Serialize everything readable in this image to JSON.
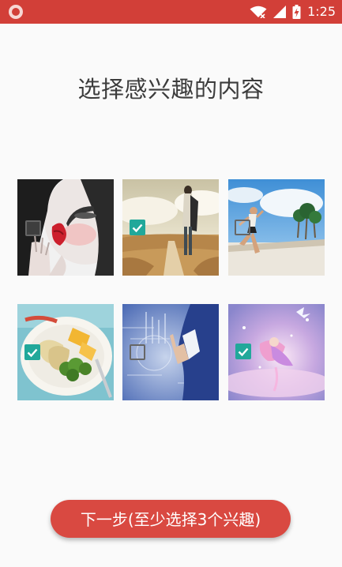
{
  "status_bar": {
    "time": "1:25",
    "background": "#d23f38",
    "icons": [
      "app-notification-icon",
      "wifi-icon",
      "cellular-signal-icon",
      "battery-charging-icon"
    ]
  },
  "page": {
    "title": "选择感兴趣的内容"
  },
  "interests": [
    {
      "name": "interest-fashion-portrait",
      "checked": false
    },
    {
      "name": "interest-travel-desert-road",
      "checked": true
    },
    {
      "name": "interest-running-beach",
      "checked": false
    },
    {
      "name": "interest-food-plate",
      "checked": true
    },
    {
      "name": "interest-technology-hand",
      "checked": false
    },
    {
      "name": "interest-fantasy-art",
      "checked": true
    }
  ],
  "actions": {
    "next_label": "下一步(至少选择3个兴趣)"
  },
  "colors": {
    "accent": "#d94941",
    "checkbox_checked": "#21a89a"
  }
}
